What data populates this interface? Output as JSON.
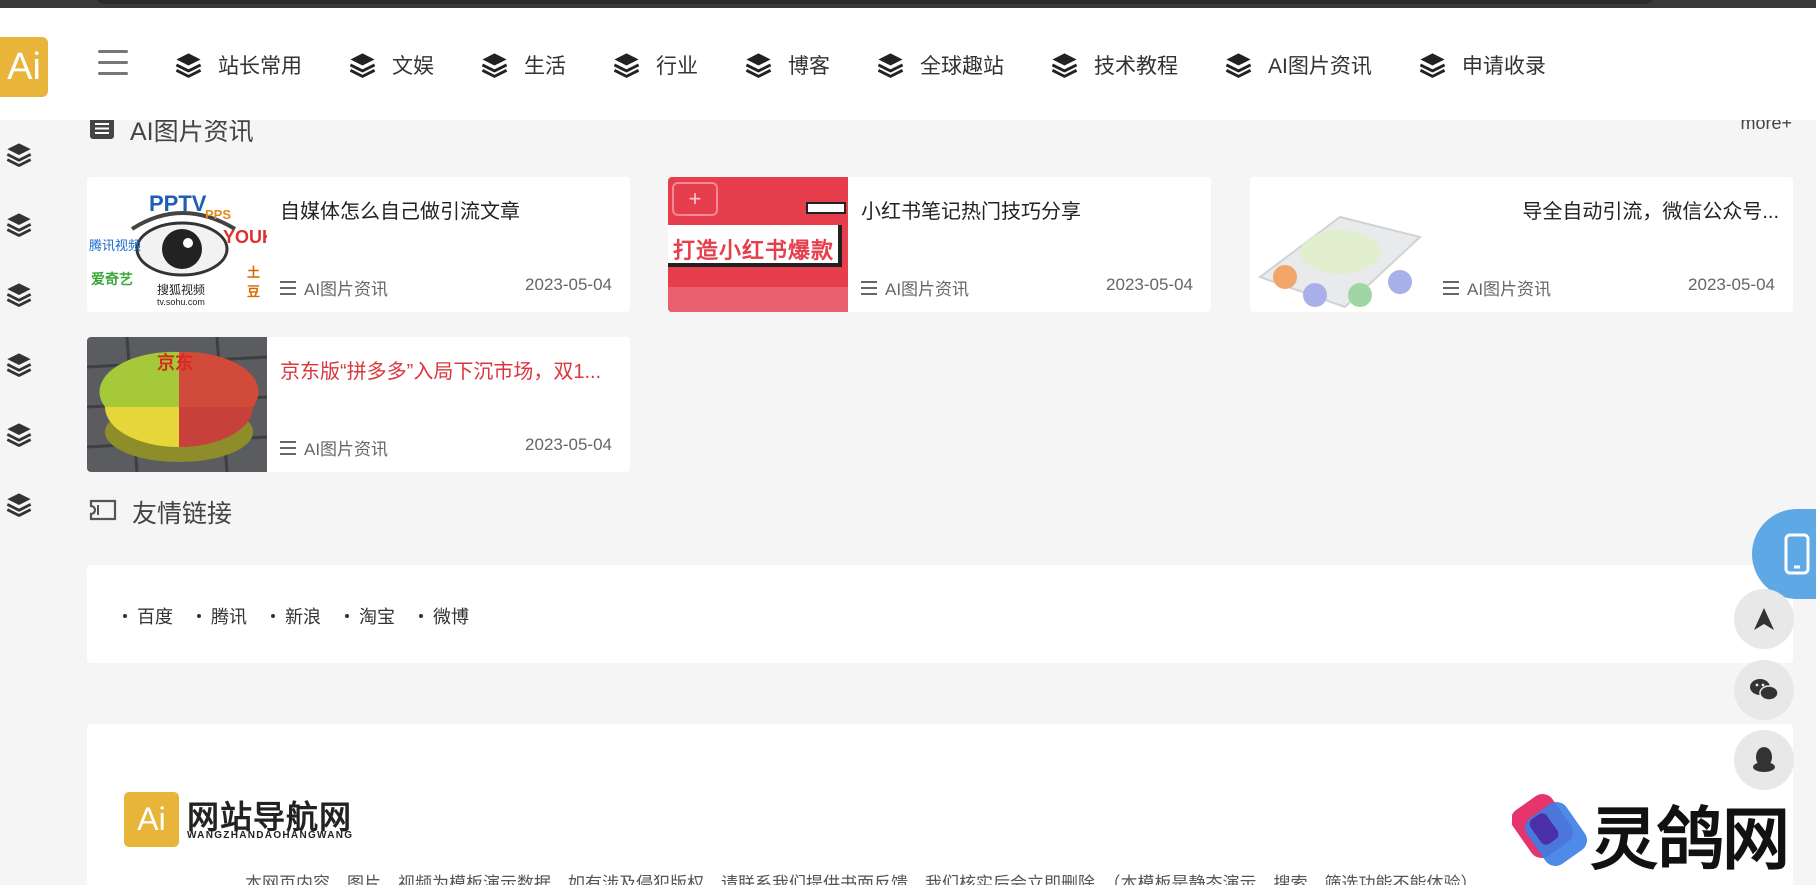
{
  "header": {
    "logo_text": "Ai",
    "nav": [
      {
        "label": "站长常用"
      },
      {
        "label": "文娱"
      },
      {
        "label": "生活"
      },
      {
        "label": "行业"
      },
      {
        "label": "博客"
      },
      {
        "label": "全球趣站"
      },
      {
        "label": "技术教程"
      },
      {
        "label": "AI图片资讯"
      },
      {
        "label": "申请收录"
      }
    ]
  },
  "ai_section": {
    "title": "AI图片资讯",
    "more": "more+",
    "cards": [
      {
        "title": "自媒体怎么自己做引流文章",
        "category": "AI图片资讯",
        "date": "2023-05-04"
      },
      {
        "title": "小红书笔记热门技巧分享",
        "category": "AI图片资讯",
        "date": "2023-05-04"
      },
      {
        "title": "导全自动引流，微信公众号...",
        "category": "AI图片资讯",
        "date": "2023-05-04"
      },
      {
        "title": "京东版“拼多多”入局下沉市场，双1...",
        "category": "AI图片资讯",
        "date": "2023-05-04"
      }
    ]
  },
  "thumbs": {
    "card2_banner": "打造小红书爆款",
    "card4_brand": "京东",
    "card1_logos": [
      "PPTV",
      "PPS",
      "YOUKU",
      "腾讯视频",
      "爱奇艺",
      "搜狐视频",
      "tv.sohu.com",
      "土豆"
    ]
  },
  "links_section": {
    "title": "友情链接",
    "links": [
      "百度",
      "腾讯",
      "新浪",
      "淘宝",
      "微博"
    ]
  },
  "footer": {
    "logo_text": "Ai",
    "brand": "网站导航网",
    "brand_sub": "WANGZHANDAOHANGWANG",
    "disclaimer": "本网页内容、图片、视频为模板演示数据，如有涉及侵犯版权，请联系我们提供书面反馈，我们核实后会立即删除。（本模板是静态演示，搜索、筛选功能不能体验）"
  },
  "watermark": "灵鸽网",
  "colors": {
    "accent": "#e8b53a",
    "highlight_title": "#d9373f",
    "phone_button": "#5ea8e6"
  }
}
